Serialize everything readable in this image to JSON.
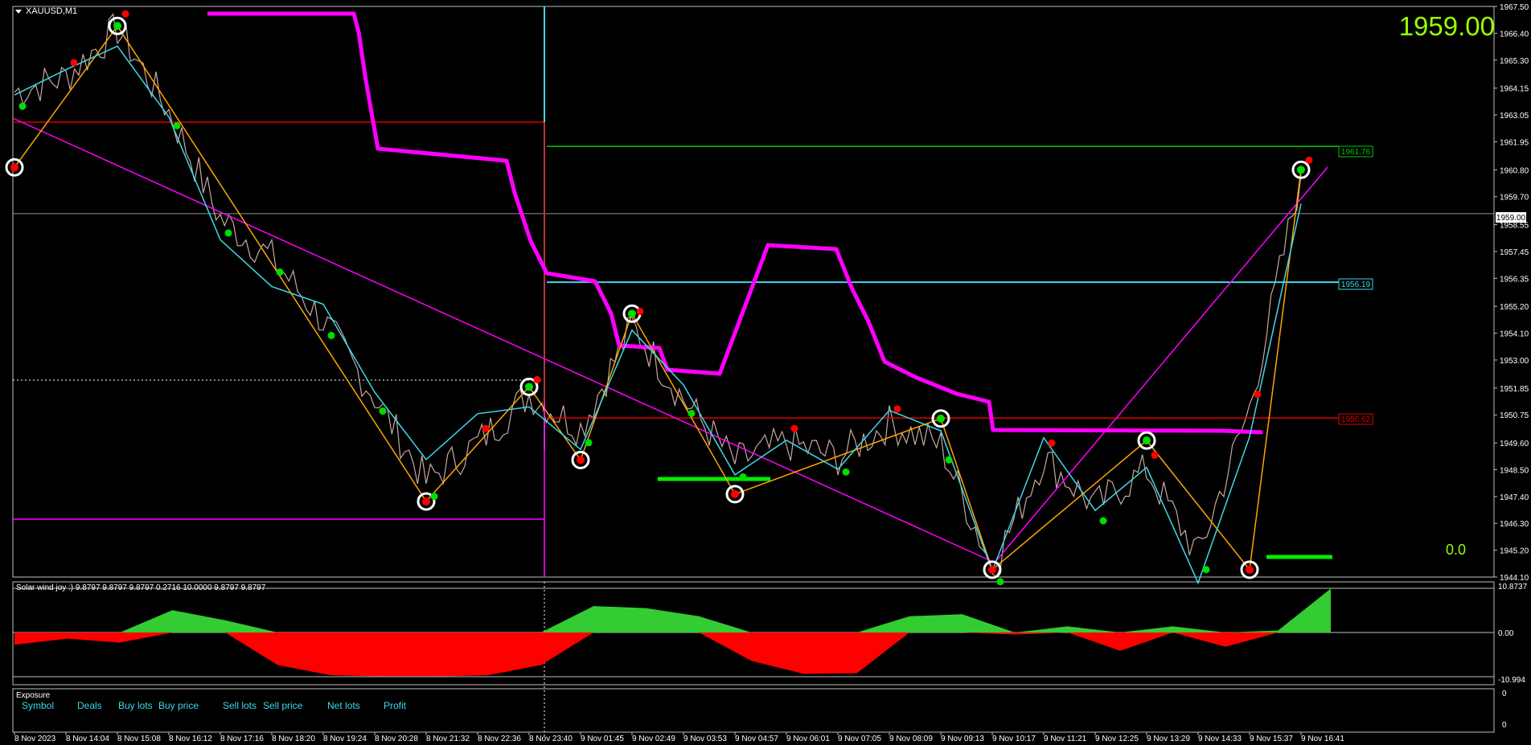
{
  "window": {
    "symbol_label": "XAUUSD,M1",
    "menu_arrow_icon": "caret-down-icon"
  },
  "main": {
    "price_big": "1959.00",
    "corner_value": "0.0",
    "price_axis": [
      "1967.50",
      "1966.40",
      "1965.30",
      "1964.15",
      "1963.05",
      "1961.95",
      "1960.80",
      "1959.70",
      "1958.55",
      "1957.45",
      "1956.35",
      "1955.20",
      "1954.10",
      "1953.00",
      "1951.85",
      "1950.75",
      "1949.60",
      "1948.50",
      "1947.40",
      "1946.30",
      "1945.20",
      "1944.10"
    ],
    "current_price_label": "1959.00",
    "level_labels": {
      "green": "1961.76",
      "cyan": "1956.19",
      "red": "1950.62"
    }
  },
  "indicator": {
    "title": "Solar wind joy :) 9.8797 9.8797 9.8797 0.2716 10.0000 9.8797 9.8797",
    "axis_top": "10.8737",
    "axis_zero": "0.00",
    "axis_bottom": "-10.994"
  },
  "exposure": {
    "title": "Exposure",
    "columns": [
      "Symbol",
      "Deals",
      "Buy lots",
      "Buy price",
      "Sell lots",
      "Sell price",
      "Net lots",
      "Profit"
    ],
    "axis_top": "0",
    "axis_bottom": "0"
  },
  "time_axis": [
    "8 Nov 2023",
    "8 Nov 14:04",
    "8 Nov 15:08",
    "8 Nov 16:12",
    "8 Nov 17:16",
    "8 Nov 18:20",
    "8 Nov 19:24",
    "8 Nov 20:28",
    "8 Nov 21:32",
    "8 Nov 22:36",
    "8 Nov 23:40",
    "9 Nov 01:45",
    "9 Nov 02:49",
    "9 Nov 03:53",
    "9 Nov 04:57",
    "9 Nov 06:01",
    "9 Nov 07:05",
    "9 Nov 08:09",
    "9 Nov 09:13",
    "9 Nov 10:17",
    "9 Nov 11:21",
    "9 Nov 12:25",
    "9 Nov 13:29",
    "9 Nov 14:33",
    "9 Nov 15:37",
    "9 Nov 16:41"
  ],
  "colors": {
    "bg": "#000000",
    "candle": "#c9a9a0",
    "zigzag_orange": "#ffa500",
    "zigzag_cyan": "#3fd8e8",
    "magenta": "#ff00ff",
    "green_level": "#00cc00",
    "red_level": "#e00000",
    "osc_green": "#33cc33",
    "osc_red": "#ff0000",
    "big_price": "#9aff00"
  },
  "chart_data": {
    "type": "line",
    "symbol": "XAUUSD",
    "timeframe": "M1",
    "ylim": [
      1944.1,
      1967.5
    ],
    "x": [
      "8 Nov 2023",
      "8 Nov 14:04",
      "8 Nov 15:08",
      "8 Nov 16:12",
      "8 Nov 17:16",
      "8 Nov 18:20",
      "8 Nov 19:24",
      "8 Nov 20:28",
      "8 Nov 21:32",
      "8 Nov 22:36",
      "8 Nov 23:40",
      "9 Nov 01:45",
      "9 Nov 02:49",
      "9 Nov 03:53",
      "9 Nov 04:57",
      "9 Nov 06:01",
      "9 Nov 07:05",
      "9 Nov 08:09",
      "9 Nov 09:13",
      "9 Nov 10:17",
      "9 Nov 11:21",
      "9 Nov 12:25",
      "9 Nov 13:29",
      "9 Nov 14:33",
      "9 Nov 15:37",
      "9 Nov 16:41"
    ],
    "series": [
      {
        "values": [
          1964.0,
          1964.6,
          1966.6,
          1963.2,
          1958.8,
          1957.2,
          1954.6,
          1951.5,
          1948.0,
          1949.6,
          1951.6,
          1950.2,
          1954.4,
          1951.4,
          1948.8,
          1949.6,
          1949.0,
          1950.4,
          1949.5,
          1944.5,
          1949.0,
          1947.0,
          1948.5,
          1945.0,
          1951.0,
          1960.6
        ]
      }
    ],
    "horizontal_levels": [
      {
        "value": 1961.76,
        "color": "#00cc00"
      },
      {
        "value": 1956.19,
        "color": "#3fd8e8"
      },
      {
        "value": 1950.62,
        "color": "#e00000"
      },
      {
        "value": 1959.0,
        "color": "#c0c0c0"
      }
    ],
    "zigzag": [
      {
        "x": "8 Nov 2023",
        "y": 1960.9
      },
      {
        "x": "8 Nov 15:08",
        "y": 1966.7
      },
      {
        "x": "8 Nov 21:32",
        "y": 1947.2
      },
      {
        "x": "8 Nov 23:40",
        "y": 1951.9
      },
      {
        "x": "9 Nov 01:45",
        "y": 1948.9
      },
      {
        "x": "9 Nov 02:49",
        "y": 1954.9
      },
      {
        "x": "9 Nov 04:57",
        "y": 1947.5
      },
      {
        "x": "9 Nov 09:13",
        "y": 1950.6
      },
      {
        "x": "9 Nov 10:17",
        "y": 1944.4
      },
      {
        "x": "9 Nov 13:29",
        "y": 1949.7
      },
      {
        "x": "9 Nov 15:37",
        "y": 1944.4
      },
      {
        "x": "9 Nov 16:41",
        "y": 1960.8
      }
    ],
    "oscillator": {
      "ylim": [
        -10.994,
        10.8737
      ],
      "values": [
        -3,
        -1.5,
        -2.5,
        5.5,
        3,
        -8,
        -10.5,
        -10.8,
        -10.8,
        -10.5,
        -8,
        6.5,
        6,
        4,
        -7,
        -10.2,
        -10,
        4,
        4.5,
        -0.5,
        1.5,
        -4.5,
        1.5,
        -3.5,
        0.5,
        10.8
      ]
    }
  }
}
